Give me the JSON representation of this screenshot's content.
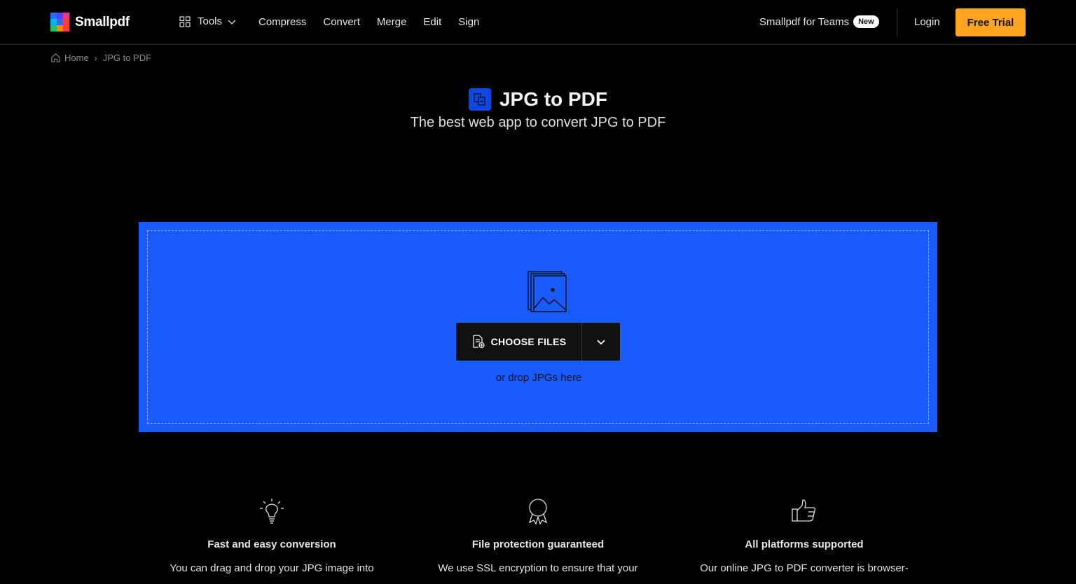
{
  "header": {
    "brand": "Smallpdf",
    "tools_label": "Tools",
    "nav": [
      "Compress",
      "Convert",
      "Merge",
      "Edit",
      "Sign"
    ],
    "teams_label": "Smallpdf for Teams",
    "teams_badge": "New",
    "login_label": "Login",
    "trial_label": "Free Trial"
  },
  "breadcrumb": {
    "home": "Home",
    "separator": "›",
    "current": "JPG to PDF"
  },
  "hero": {
    "title": "JPG to PDF",
    "subtitle": "The best web app to convert JPG to PDF"
  },
  "dropzone": {
    "choose_label": "CHOOSE FILES",
    "drop_hint": "or drop JPGs here",
    "icon": "image-files-icon"
  },
  "features": [
    {
      "icon": "lightbulb-icon",
      "title": "Fast and easy conversion",
      "text": "You can drag and drop your JPG image into"
    },
    {
      "icon": "award-ribbon-icon",
      "title": "File protection guaranteed",
      "text": "We use SSL encryption to ensure that your"
    },
    {
      "icon": "thumbs-up-icon",
      "title": "All platforms supported",
      "text": "Our online JPG to PDF converter is browser-"
    }
  ],
  "colors": {
    "accent_blue": "#1a5bff",
    "title_icon_blue": "#0d47e6",
    "trial_orange": "#ffa51f",
    "background": "#000000"
  }
}
